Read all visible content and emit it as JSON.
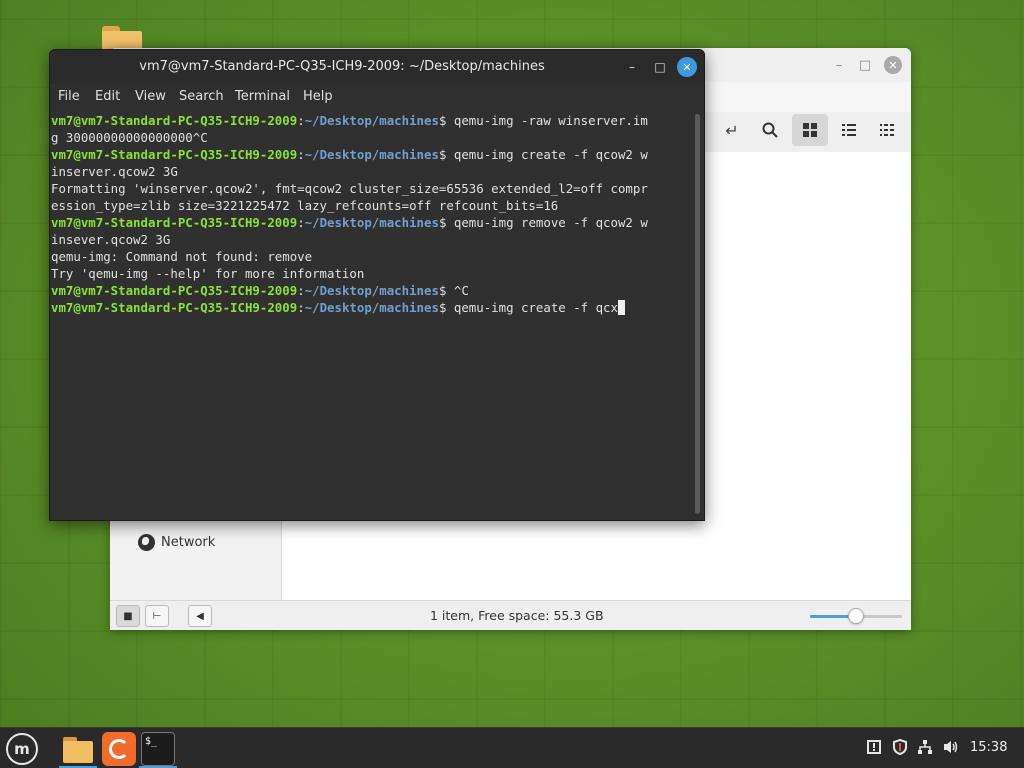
{
  "file_manager": {
    "sidebar": {
      "network_label": "Network"
    },
    "statusbar": {
      "text": "1 item, Free space: 55.3 GB",
      "zoom_level": 0.5
    }
  },
  "terminal": {
    "title": "vm7@vm7-Standard-PC-Q35-ICH9-2009: ~/Desktop/machines",
    "menu": [
      "File",
      "Edit",
      "View",
      "Search",
      "Terminal",
      "Help"
    ],
    "prompt_user": "vm7@vm7-Standard-PC-Q35-ICH9-2009",
    "prompt_path": "~/Desktop/machines",
    "lines": [
      {
        "user": "vm7@vm7-Standard-PC-Q35-ICH9-2009",
        "path": "~/Desktop/machines",
        "text": "$ qemu-img -raw winserver.im"
      },
      {
        "text": "g 30000000000000000^C"
      },
      {
        "user": "vm7@vm7-Standard-PC-Q35-ICH9-2009",
        "path": "~/Desktop/machines",
        "text": "$ qemu-img create -f qcow2 w"
      },
      {
        "text": "inserver.qcow2 3G"
      },
      {
        "text": "Formatting 'winserver.qcow2', fmt=qcow2 cluster_size=65536 extended_l2=off compr"
      },
      {
        "text": "ession_type=zlib size=3221225472 lazy_refcounts=off refcount_bits=16"
      },
      {
        "user": "vm7@vm7-Standard-PC-Q35-ICH9-2009",
        "path": "~/Desktop/machines",
        "text": "$ qemu-img remove -f qcow2 w"
      },
      {
        "text": "insever.qcow2 3G"
      },
      {
        "text": "qemu-img: Command not found: remove"
      },
      {
        "text": "Try 'qemu-img --help' for more information"
      },
      {
        "user": "vm7@vm7-Standard-PC-Q35-ICH9-2009",
        "path": "~/Desktop/machines",
        "text": "$ ^C"
      },
      {
        "user": "vm7@vm7-Standard-PC-Q35-ICH9-2009",
        "path": "~/Desktop/machines",
        "text": "$ qemu-img create -f qcx",
        "cursor": true
      }
    ]
  },
  "taskbar": {
    "menu_icon": "linux-mint-logo-icon",
    "apps": [
      "files-icon",
      "firefox-icon",
      "terminal-icon"
    ],
    "tray_icons": [
      "update-manager-icon",
      "shield-icon",
      "network-icon",
      "volume-icon"
    ],
    "clock": "15:38"
  },
  "colors": {
    "prompt_user": "#8ae234",
    "prompt_path": "#729fcf",
    "terminal_bg": "#303030",
    "accent": "#3d9ae0"
  }
}
